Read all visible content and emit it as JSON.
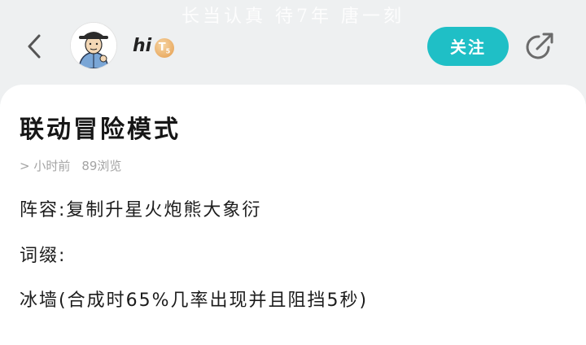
{
  "watermark": "长当认真 待7年 唐一刻",
  "header": {
    "username": "hi",
    "level": "T",
    "level_sub": "5",
    "follow_label": "关注"
  },
  "post": {
    "title": "联动冒险模式",
    "time_ago": "> 小时前",
    "views": "89浏览",
    "lines": [
      "阵容:复制升星火炮熊大象衍",
      "词缀:",
      "冰墙(合成时65%几率出现并且阻挡5秒)"
    ]
  },
  "colors": {
    "accent": "#1fbfc6",
    "background": "#eef0f1",
    "card": "#ffffff"
  },
  "icons": {
    "back": "chevron-left-icon",
    "share": "share-arrow-icon",
    "level": "level-badge-icon"
  }
}
